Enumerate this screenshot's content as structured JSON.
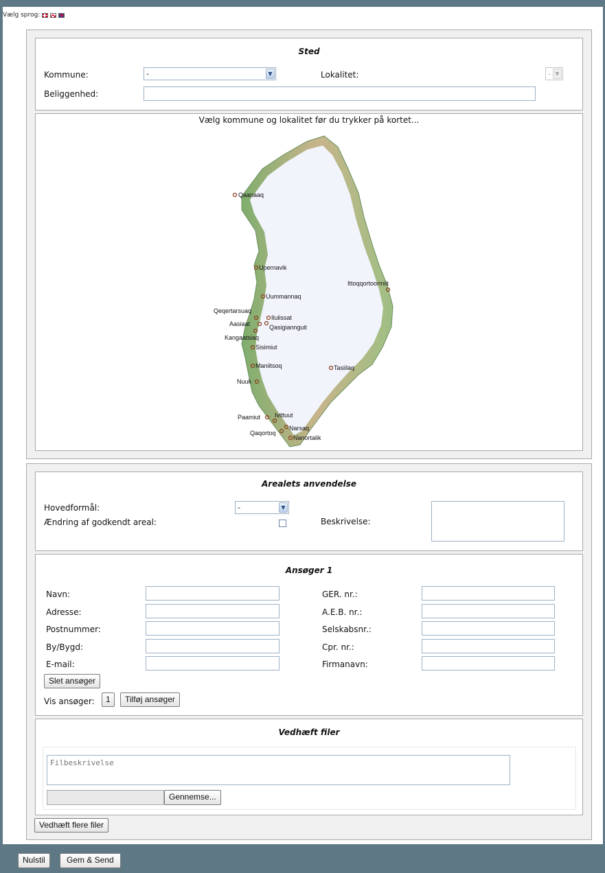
{
  "language": {
    "label": "Vælg sprog:",
    "flags": [
      "danish-flag-icon",
      "greenlandic-flag-icon",
      "english-flag-icon"
    ]
  },
  "sted": {
    "title": "Sted",
    "kommune_label": "Kommune:",
    "kommune_value": "-",
    "lokalitet_label": "Lokalitet:",
    "lokalitet_value": "-",
    "beliggenhed_label": "Beliggenhed:",
    "beliggenhed_value": ""
  },
  "map": {
    "caption": "Vælg kommune og lokalitet før du trykker på kortet...",
    "towns": [
      "Qaanaaq",
      "Upernavik",
      "Ittoqqortoormiit",
      "Uummannaq",
      "Qeqertarsuaq",
      "Ilulissat",
      "Aasiaat",
      "Qasigiannguit",
      "Kangaatsiaq",
      "Sisimiut",
      "Maniitsoq",
      "Tasiilaq",
      "Nuuk",
      "Paamiut",
      "Ivittuut",
      "Narsaq",
      "Qaqortoq",
      "Nanortalik"
    ]
  },
  "anvendelse": {
    "title": "Arealets anvendelse",
    "hovedformaal_label": "Hovedformål:",
    "hovedformaal_value": "-",
    "aendring_label": "Ændring af godkendt areal:",
    "beskrivelse_label": "Beskrivelse:",
    "beskrivelse_value": ""
  },
  "ansoeger": {
    "title": "Ansøger 1",
    "left_fields": [
      "Navn:",
      "Adresse:",
      "Postnummer:",
      "By/Bygd:",
      "E-mail:"
    ],
    "right_fields": [
      "GER. nr.:",
      "A.E.B. nr.:",
      "Selskabsnr.:",
      "Cpr. nr.:",
      "Firmanavn:"
    ],
    "slet_button": "Slet ansøger",
    "vis_label": "Vis ansøger:",
    "page_button": "1",
    "tilfoej_button": "Tilføj ansøger"
  },
  "vedhaeft": {
    "title": "Vedhæft filer",
    "filbeskrivelse": "Filbeskrivelse",
    "browse_button": "Gennemse...",
    "flere_button": "Vedhæft flere filer"
  },
  "footer": {
    "reset_button": "Nulstil",
    "send_button": "Gem & Send"
  },
  "colors": {
    "background": "#5f7885",
    "panel_border": "#a9a9a9",
    "input_border": "#9cb0c6"
  }
}
